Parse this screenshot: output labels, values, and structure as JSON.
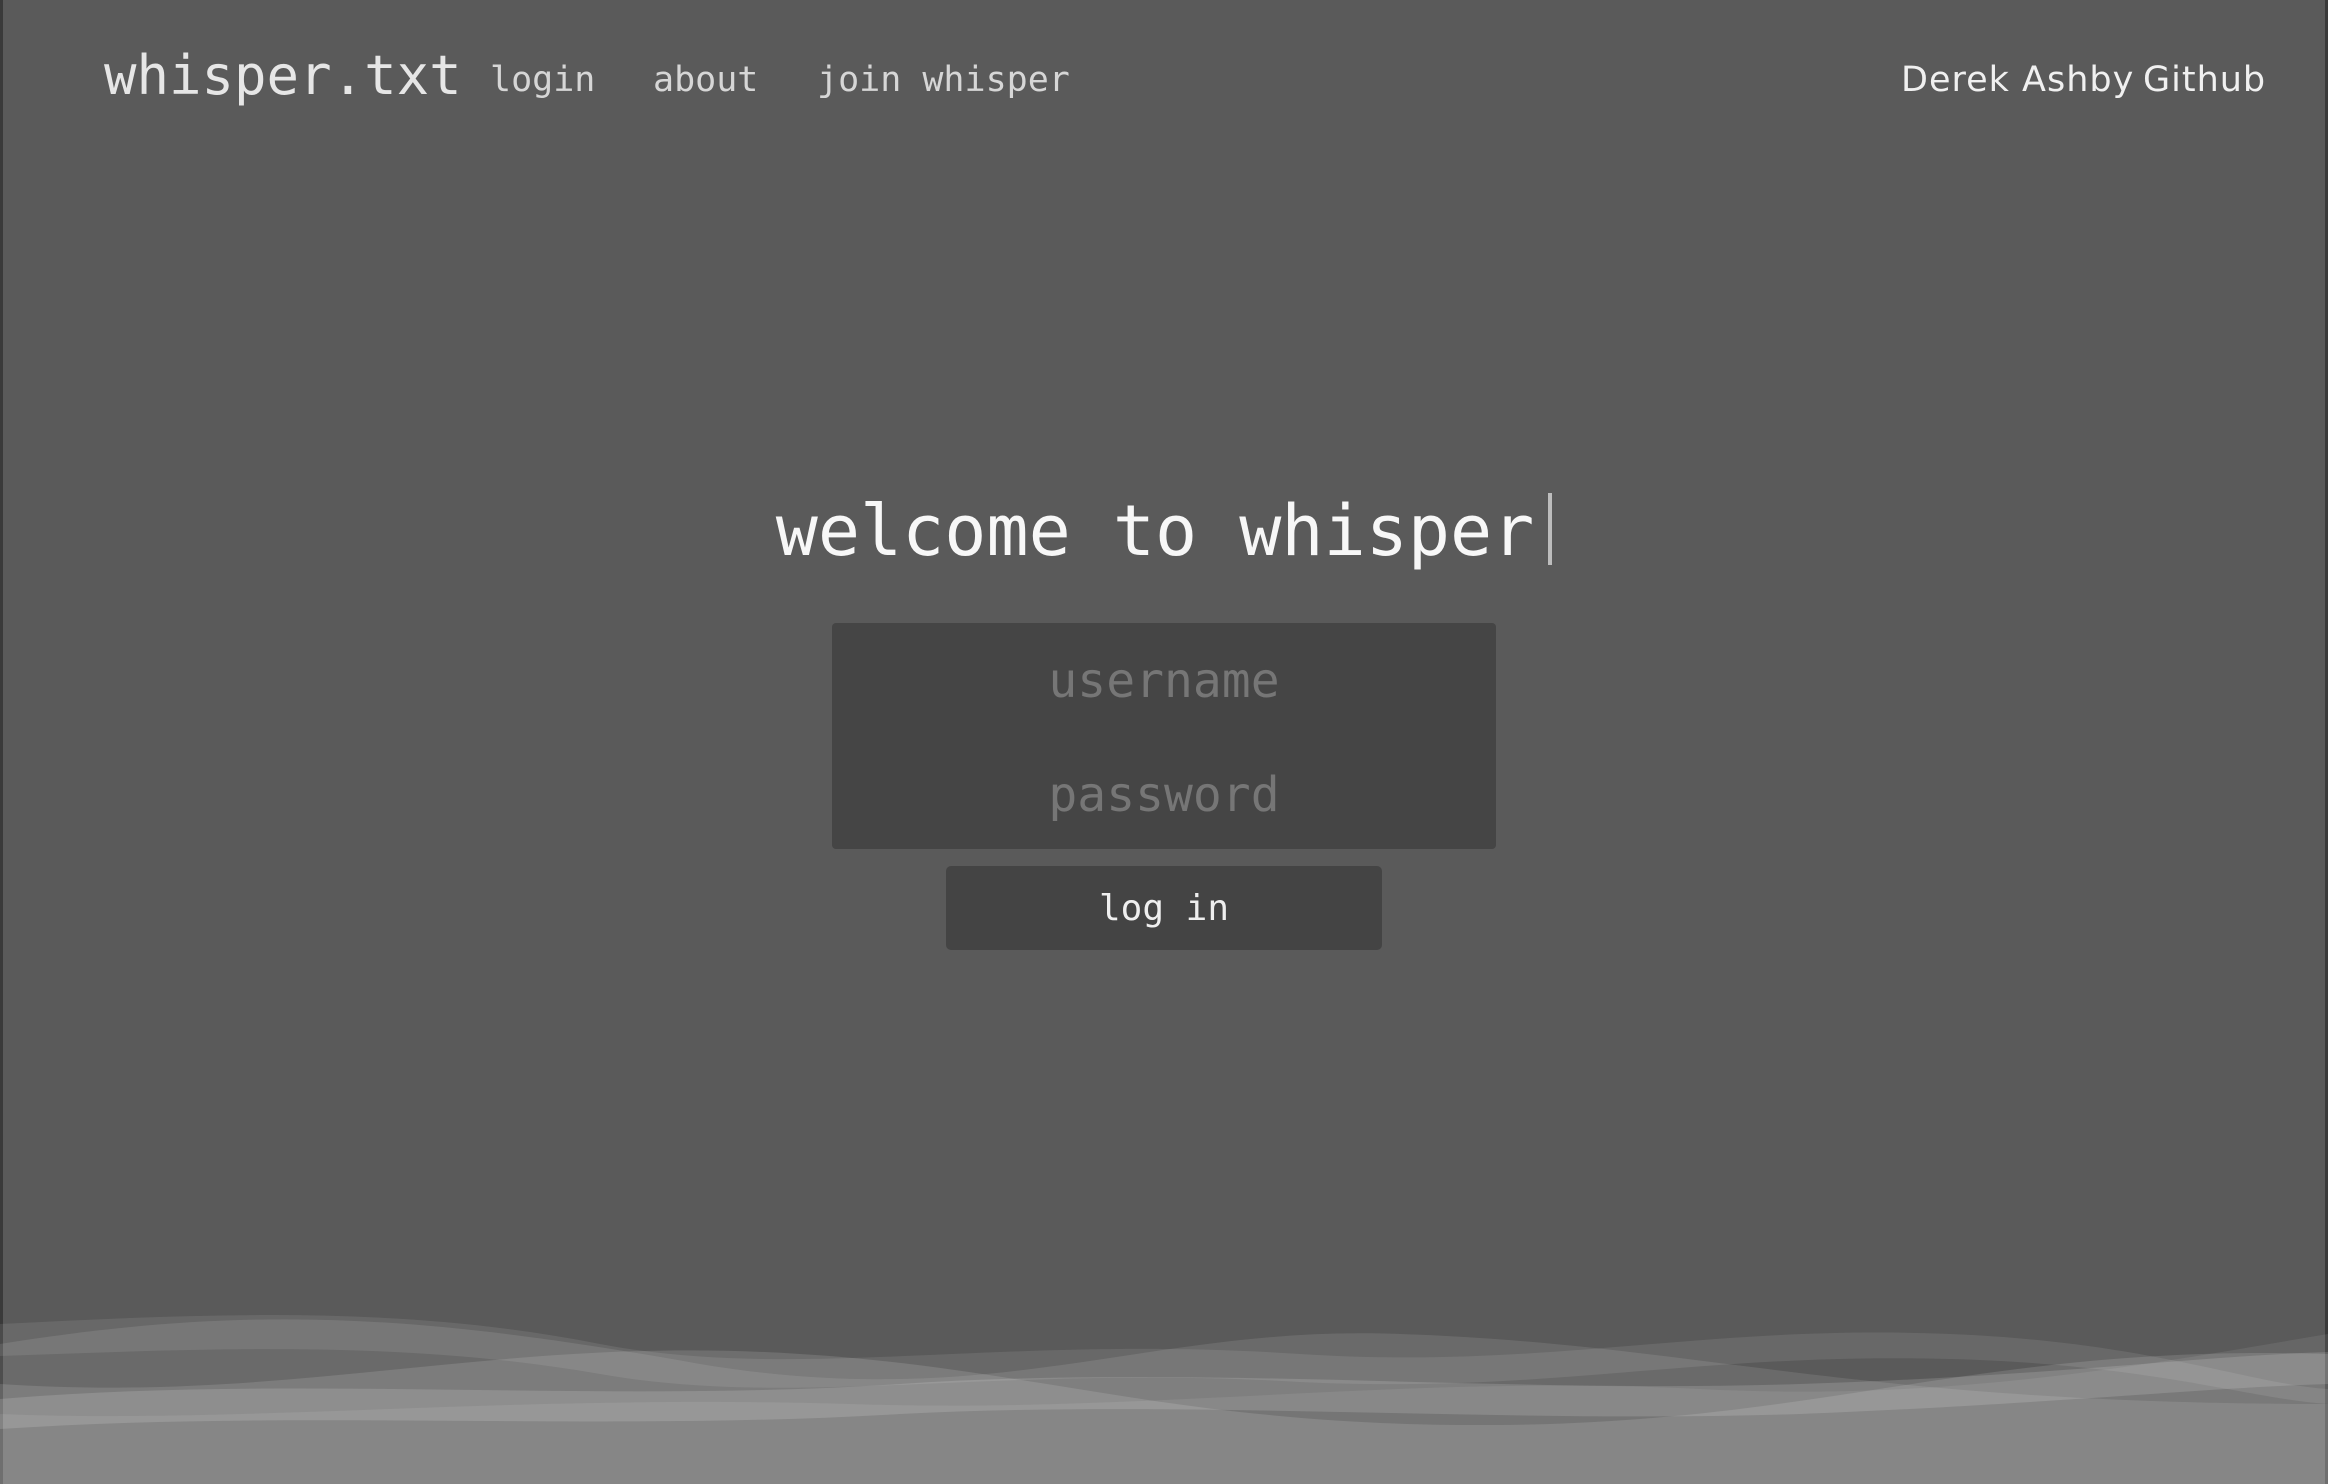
{
  "nav": {
    "brand": "whisper.txt",
    "links": [
      {
        "label": "login"
      },
      {
        "label": "about"
      },
      {
        "label": "join whisper"
      }
    ],
    "right": {
      "author": "Derek Ashby",
      "github": "Github"
    }
  },
  "hero": {
    "heading": "welcome to whisper"
  },
  "form": {
    "username_placeholder": "username",
    "password_placeholder": "password",
    "submit_label": "log in"
  },
  "colors": {
    "background": "#5a5a5a",
    "panel": "#454545",
    "text": "#e8e8e8",
    "placeholder": "#767676"
  }
}
